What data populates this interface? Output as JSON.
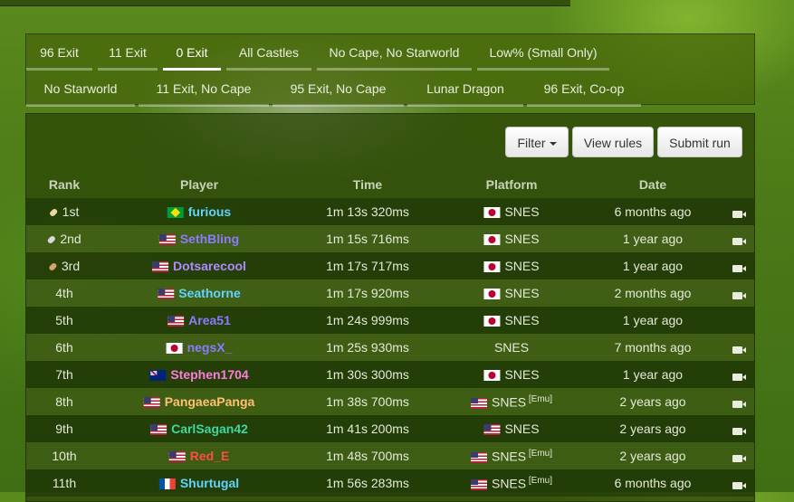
{
  "tabs_row1": [
    {
      "label": "96 Exit"
    },
    {
      "label": "11 Exit"
    },
    {
      "label": "0 Exit",
      "active": true
    },
    {
      "label": "All Castles"
    },
    {
      "label": "No Cape, No Starworld"
    },
    {
      "label": "Low% (Small Only)"
    }
  ],
  "tabs_row2": [
    {
      "label": "No Starworld"
    },
    {
      "label": "11 Exit, No Cape"
    },
    {
      "label": "95 Exit, No Cape"
    },
    {
      "label": "Lunar Dragon"
    },
    {
      "label": "96 Exit, Co-op"
    }
  ],
  "toolbar": {
    "filter": "Filter",
    "rules": "View rules",
    "submit": "Submit run"
  },
  "columns": {
    "rank": "Rank",
    "player": "Player",
    "time": "Time",
    "platform": "Platform",
    "date": "Date"
  },
  "colors": {
    "gold": "#e8d9a0",
    "silver": "#d8d8d8",
    "bronze": "#d9a070"
  },
  "runs": [
    {
      "rank": "1st",
      "player": "furious",
      "flag": "br",
      "color": "#5fd4ff",
      "time": "1m 13s 320ms",
      "plat_flag": "jp",
      "platform": "SNES",
      "emu": "",
      "date": "6 months ago",
      "video": true,
      "trophy": "gold"
    },
    {
      "rank": "2nd",
      "player": "SethBling",
      "flag": "us",
      "color": "#8a7bff",
      "time": "1m 15s 716ms",
      "plat_flag": "jp",
      "platform": "SNES",
      "emu": "",
      "date": "1 year ago",
      "video": true,
      "trophy": "silver"
    },
    {
      "rank": "3rd",
      "player": "Dotsarecool",
      "flag": "us",
      "color": "#b088ff",
      "time": "1m 17s 717ms",
      "plat_flag": "jp",
      "platform": "SNES",
      "emu": "",
      "date": "1 year ago",
      "video": true,
      "trophy": "bronze"
    },
    {
      "rank": "4th",
      "player": "Seathorne",
      "flag": "us",
      "color": "#5fd4ff",
      "time": "1m 17s 920ms",
      "plat_flag": "jp",
      "platform": "SNES",
      "emu": "",
      "date": "2 months ago",
      "video": true,
      "trophy": ""
    },
    {
      "rank": "5th",
      "player": "Area51",
      "flag": "us",
      "color": "#8a7bff",
      "time": "1m 24s 999ms",
      "plat_flag": "jp",
      "platform": "SNES",
      "emu": "",
      "date": "1 year ago",
      "video": false,
      "trophy": ""
    },
    {
      "rank": "6th",
      "player": "negsX_",
      "flag": "jp",
      "color": "#8a7bff",
      "time": "1m 25s 930ms",
      "plat_flag": "",
      "platform": "SNES",
      "emu": "",
      "date": "7 months ago",
      "video": true,
      "trophy": ""
    },
    {
      "rank": "7th",
      "player": "Stephen1704",
      "flag": "au",
      "color": "#ff7be0",
      "time": "1m 30s 300ms",
      "plat_flag": "jp",
      "platform": "SNES",
      "emu": "",
      "date": "1 year ago",
      "video": true,
      "trophy": ""
    },
    {
      "rank": "8th",
      "player": "PangaeaPanga",
      "flag": "us",
      "color": "#ffc070",
      "time": "1m 38s 700ms",
      "plat_flag": "us",
      "platform": "SNES",
      "emu": "[Emu]",
      "date": "2 years ago",
      "video": true,
      "trophy": ""
    },
    {
      "rank": "9th",
      "player": "CarlSagan42",
      "flag": "us",
      "color": "#3fd8a0",
      "time": "1m 41s 200ms",
      "plat_flag": "us",
      "platform": "SNES",
      "emu": "",
      "date": "2 years ago",
      "video": true,
      "trophy": ""
    },
    {
      "rank": "10th",
      "player": "Red_E",
      "flag": "us",
      "color": "#ff4a4a",
      "time": "1m 48s 700ms",
      "plat_flag": "us",
      "platform": "SNES",
      "emu": "[Emu]",
      "date": "2 years ago",
      "video": true,
      "trophy": ""
    },
    {
      "rank": "11th",
      "player": "Shurtugal",
      "flag": "fr",
      "color": "#5fd4ff",
      "time": "1m 56s 283ms",
      "plat_flag": "us",
      "platform": "SNES",
      "emu": "[Emu]",
      "date": "6 months ago",
      "video": true,
      "trophy": ""
    }
  ]
}
